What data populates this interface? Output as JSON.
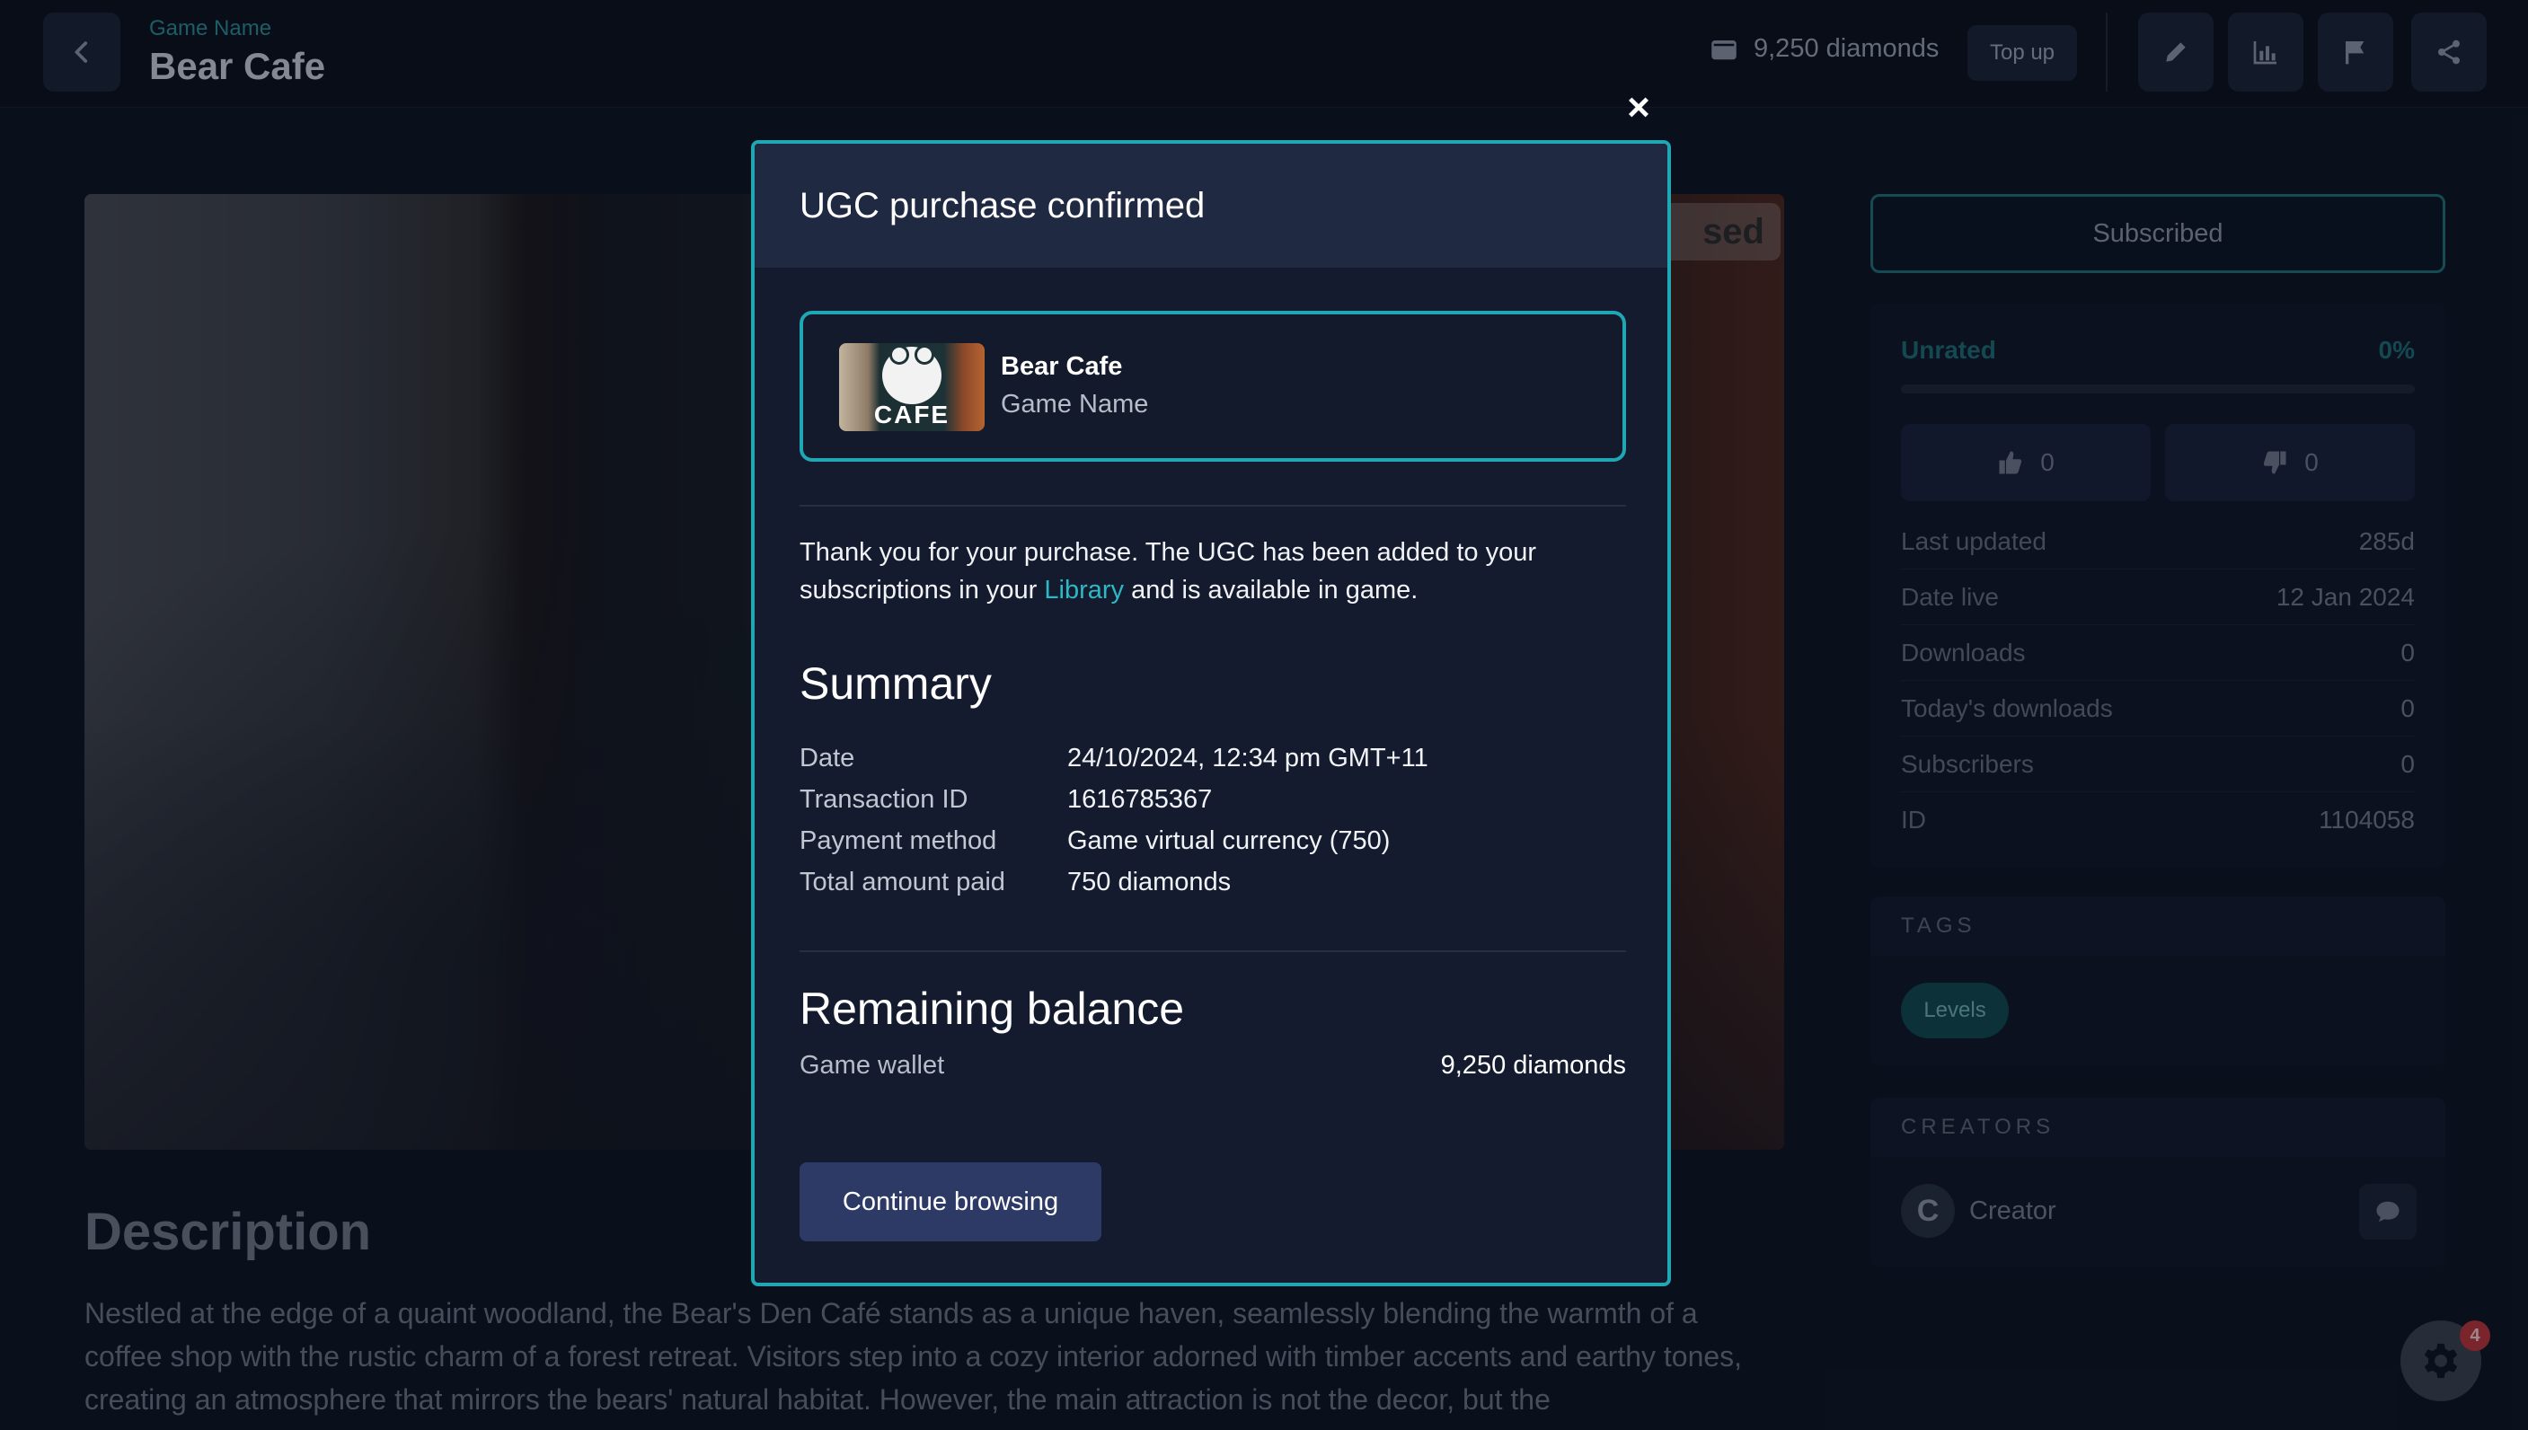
{
  "header": {
    "subtitle": "Game Name",
    "title": "Bear Cafe",
    "wallet_balance": "9,250 diamonds",
    "topup_label": "Top up",
    "icons": [
      "back-arrow-icon",
      "wallet-icon",
      "pencil-icon",
      "chart-icon",
      "flag-icon",
      "share-icon"
    ]
  },
  "hero": {
    "badge_text": "sed"
  },
  "description": {
    "title": "Description",
    "text": "Nestled at the edge of a quaint woodland, the Bear's Den Café stands as a unique haven, seamlessly blending the warmth of a coffee shop with the rustic charm of a forest retreat. Visitors step into a cozy interior adorned with timber accents and earthy tones, creating an atmosphere that mirrors the bears' natural habitat. However, the main attraction is not the decor, but the"
  },
  "sidebar": {
    "subscribed_label": "Subscribed",
    "rating": {
      "label": "Unrated",
      "percent": "0%"
    },
    "likes": "0",
    "dislikes": "0",
    "stats": [
      {
        "label": "Last updated",
        "value": "285d"
      },
      {
        "label": "Date live",
        "value": "12 Jan 2024"
      },
      {
        "label": "Downloads",
        "value": "0"
      },
      {
        "label": "Today's downloads",
        "value": "0"
      },
      {
        "label": "Subscribers",
        "value": "0"
      },
      {
        "label": "ID",
        "value": "1104058"
      }
    ],
    "tags_title": "TAGS",
    "tags": [
      "Levels"
    ],
    "creators_title": "CREATORS",
    "creator": {
      "initial": "C",
      "name": "Creator"
    }
  },
  "settings_badge": "4",
  "modal": {
    "close_label": "×",
    "title": "UGC purchase confirmed",
    "item": {
      "name": "Bear Cafe",
      "subtitle": "Game Name",
      "thumb_text": "CAFE"
    },
    "thanks_before": "Thank you for your purchase. The UGC has been added to your subscriptions in your ",
    "thanks_link": "Library",
    "thanks_after": " and is available in game.",
    "summary_title": "Summary",
    "summary": [
      {
        "label": "Date",
        "value": "24/10/2024, 12:34 pm GMT+11"
      },
      {
        "label": "Transaction ID",
        "value": "1616785367"
      },
      {
        "label": "Payment method",
        "value": "Game virtual currency (750)"
      },
      {
        "label": "Total amount paid",
        "value": "750 diamonds"
      }
    ],
    "balance_title": "Remaining balance",
    "wallet_label": "Game wallet",
    "wallet_value": "9,250 diamonds",
    "continue_label": "Continue browsing"
  },
  "colors": {
    "accent": "#1fa7b3",
    "link": "#2fb7c4",
    "background": "#0d1322",
    "modal_bg": "#141b2e",
    "button": "#2d3a66"
  }
}
